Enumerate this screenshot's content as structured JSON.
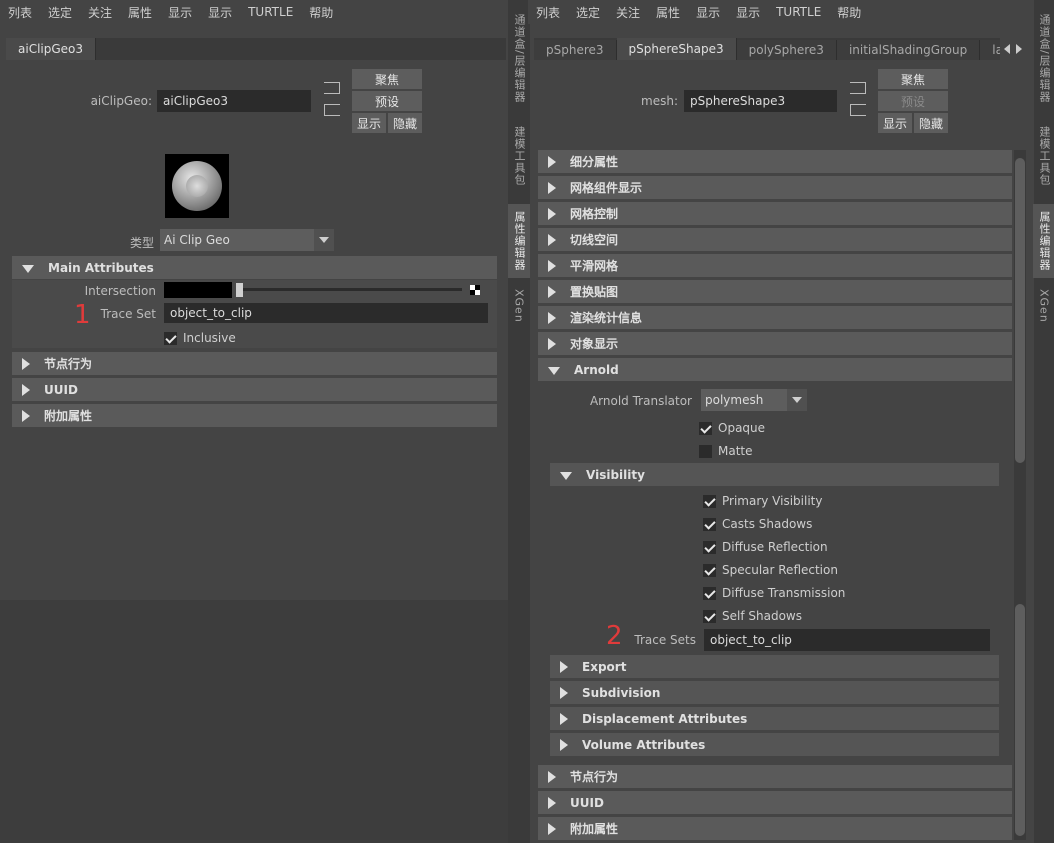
{
  "left_menu": [
    "列表",
    "选定",
    "关注",
    "属性",
    "显示",
    "显示",
    "TURTLE",
    "帮助"
  ],
  "right_menu": [
    "列表",
    "选定",
    "关注",
    "属性",
    "显示",
    "显示",
    "TURTLE",
    "帮助"
  ],
  "left": {
    "tab": "aiClipGeo3",
    "node_label": "aiClipGeo:",
    "node_value": "aiClipGeo3",
    "buttons": {
      "focus": "聚焦",
      "preset": "预设",
      "show": "显示",
      "hide": "隐藏"
    },
    "type_label": "类型",
    "type_value": "Ai Clip Geo",
    "main_section": "Main Attributes",
    "intersection_label": "Intersection",
    "trace_set_label": "Trace Set",
    "trace_set_value": "object_to_clip",
    "inclusive_label": "Inclusive",
    "marker": "1",
    "sections": [
      "节点行为",
      "UUID",
      "附加属性"
    ]
  },
  "left_vtabs": [
    "通道盒/层编辑器",
    "建模工具包",
    "属性编辑器",
    "XGen"
  ],
  "right": {
    "tabs": [
      "pSphere3",
      "pSphereShape3",
      "polySphere3",
      "initialShadingGroup",
      "laml"
    ],
    "node_label": "mesh:",
    "node_value": "pSphereShape3",
    "buttons": {
      "focus": "聚焦",
      "preset": "预设",
      "show": "显示",
      "hide": "隐藏"
    },
    "sections": [
      "细分属性",
      "网格组件显示",
      "网格控制",
      "切线空间",
      "平滑网格",
      "置换贴图",
      "渲染统计信息",
      "对象显示"
    ],
    "arnold_section": "Arnold",
    "translator_label": "Arnold Translator",
    "translator_value": "polymesh",
    "opaque_label": "Opaque",
    "matte_label": "Matte",
    "visibility_section": "Visibility",
    "visibility_items": [
      "Primary Visibility",
      "Casts Shadows",
      "Diffuse Reflection",
      "Specular Reflection",
      "Diffuse Transmission",
      "Self Shadows"
    ],
    "trace_sets_label": "Trace Sets",
    "trace_sets_value": "object_to_clip",
    "marker": "2",
    "sub_sections": [
      "Export",
      "Subdivision",
      "Displacement Attributes",
      "Volume Attributes"
    ],
    "bottom_sections": [
      "节点行为",
      "UUID",
      "附加属性"
    ]
  },
  "right_vtabs": [
    "通道盒/层编辑器",
    "建模工具包",
    "属性编辑器",
    "XGen"
  ],
  "colors": {
    "marker": "#e03b3b",
    "panel": "#444444",
    "section": "#5a5a5a",
    "field": "#2b2b2b"
  }
}
